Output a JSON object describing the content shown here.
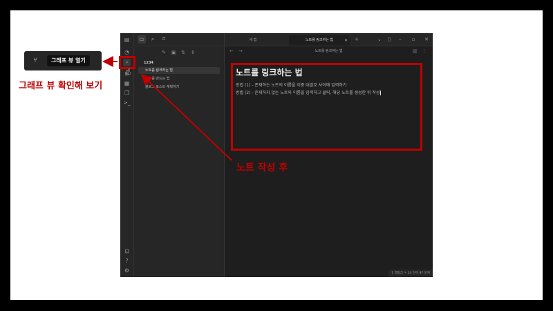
{
  "sidebar": {
    "vault_name": "1234",
    "files": [
      {
        "name": "노트를 링크하는 법",
        "active": true
      },
      {
        "name": "노트를 만드는 법",
        "active": false
      },
      {
        "name": "블로그 포스트 계획하기",
        "active": false
      }
    ]
  },
  "tabs": [
    {
      "label": "새 탭",
      "active": false
    },
    {
      "label": "노트를 링크하는 법",
      "active": true
    }
  ],
  "breadcrumb": "노트를 링크하는 법",
  "document": {
    "title": "노트를 링크하는 법",
    "lines": [
      "방법 (1) - 존재하는 노트의 이름을 이중 대괄호 사이에 입력하기",
      "방법 (2) - 존재하지 않는 노트의 이름을 입력하고 클릭, 해당 노트를 생성한 뒤 작성"
    ]
  },
  "status_bar": {
    "backlinks": "1 백링크",
    "words": "24 단어",
    "chars": "87 문자"
  },
  "tooltip": {
    "label": "그래프 뷰 열기"
  },
  "annotations": {
    "graph_view": "그래프 뷰 확인해 보기",
    "after_note": "노트 작성 후"
  },
  "colors": {
    "annotation_red": "#c00000",
    "app_bg": "#1e1e1e",
    "panel_bg": "#262626"
  },
  "icons": {
    "ribbon": [
      "sidebar-toggle-icon",
      "open-vault-icon",
      "graph-view-icon",
      "canvas-icon",
      "daily-note-icon",
      "templates-icon",
      "command-palette-icon",
      "publish-icon",
      "help-icon",
      "settings-icon"
    ],
    "tooltip": "graph-view-icon",
    "cursor": "hand-pointer-icon"
  }
}
